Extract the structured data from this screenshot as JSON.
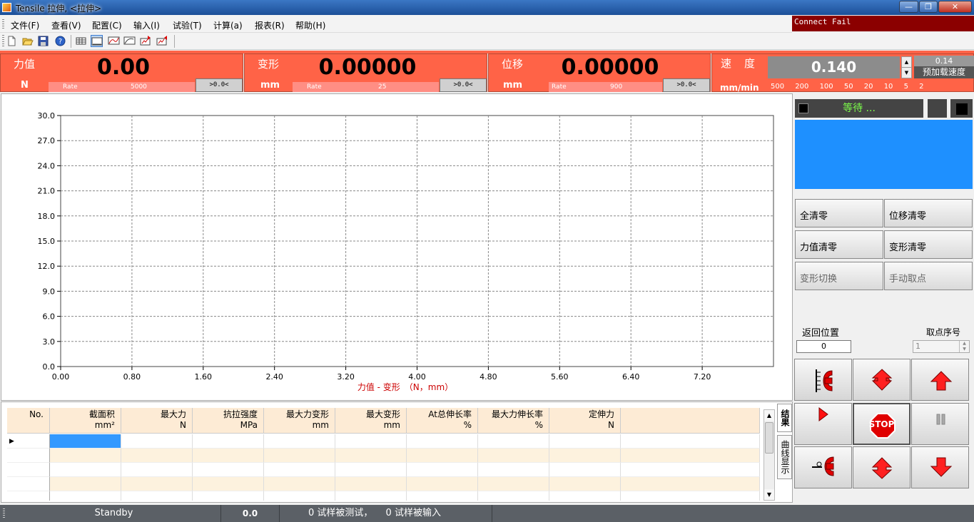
{
  "window": {
    "title": "Tensile 拉伸, <拉伸>",
    "minimize": "—",
    "maximize": "❐",
    "close": "✕"
  },
  "menu": [
    "文件(F)",
    "查看(V)",
    "配置(C)",
    "输入(I)",
    "试验(T)",
    "计算(a)",
    "报表(R)",
    "帮助(H)"
  ],
  "connection_status": "Connect Fail",
  "readouts": {
    "force": {
      "label": "力值",
      "value": "0.00",
      "unit": "N",
      "rate_label": "Rate",
      "rate_value": "5000",
      "zero_label": ">0.0<"
    },
    "deformation": {
      "label": "变形",
      "value": "0.00000",
      "unit": "mm",
      "rate_label": "Rate",
      "rate_value": "25",
      "zero_label": ">0.0<"
    },
    "displacement": {
      "label": "位移",
      "value": "0.00000",
      "unit": "mm",
      "rate_label": "Rate",
      "rate_value": "900",
      "zero_label": ">0.0<"
    }
  },
  "speed": {
    "label": "速度",
    "value": "0.140",
    "unit": "mm/min",
    "preload_value": "0.14",
    "preload_label": "预加载速度",
    "presets": [
      "500",
      "200",
      "100",
      "50",
      "20",
      "10",
      "5",
      "2"
    ]
  },
  "chart_data": {
    "type": "line",
    "title": "",
    "xlabel": "力值 - 变形　（N，mm）",
    "ylabel": "",
    "xlim": [
      0,
      8.0
    ],
    "ylim": [
      0,
      30.0
    ],
    "x_ticks": [
      "0.00",
      "0.80",
      "1.60",
      "2.40",
      "3.20",
      "4.00",
      "4.80",
      "5.60",
      "6.40",
      "7.20"
    ],
    "y_ticks": [
      "0.0",
      "3.0",
      "6.0",
      "9.0",
      "12.0",
      "15.0",
      "18.0",
      "21.0",
      "24.0",
      "27.0",
      "30.0"
    ],
    "grid": true,
    "series": []
  },
  "table": {
    "columns": [
      {
        "l1": "No.",
        "l2": ""
      },
      {
        "l1": "截面积",
        "l2": "mm²"
      },
      {
        "l1": "最大力",
        "l2": "N"
      },
      {
        "l1": "抗拉强度",
        "l2": "MPa"
      },
      {
        "l1": "最大力变形",
        "l2": "mm"
      },
      {
        "l1": "最大变形",
        "l2": "mm"
      },
      {
        "l1": "At总伸长率",
        "l2": "%"
      },
      {
        "l1": "最大力伸长率",
        "l2": "%"
      },
      {
        "l1": "定伸力",
        "l2": "N"
      }
    ],
    "row_marker": "▶",
    "tabs": [
      "结果",
      "曲线显示"
    ]
  },
  "status": {
    "label": "等待 ...",
    "buttons": {
      "clear_all": "全清零",
      "clear_displacement": "位移清零",
      "clear_force": "力值清零",
      "clear_deformation": "变形清零",
      "switch_deformation": "变形切换",
      "manual_pick": "手动取点"
    },
    "return_position_label": "返回位置",
    "return_position_value": "0",
    "point_index_label": "取点序号",
    "point_index_value": "1",
    "stop_label": "STOP"
  },
  "statusbar": {
    "state": "Standby",
    "value": "0.0",
    "tested": "0  试样被测试，",
    "input": "0  试样被输入"
  },
  "colors": {
    "readout_bg": "#ff6347",
    "accent_blue": "#1e90ff",
    "state_green": "#7cff4a",
    "arrow_red": "#ff0000"
  }
}
